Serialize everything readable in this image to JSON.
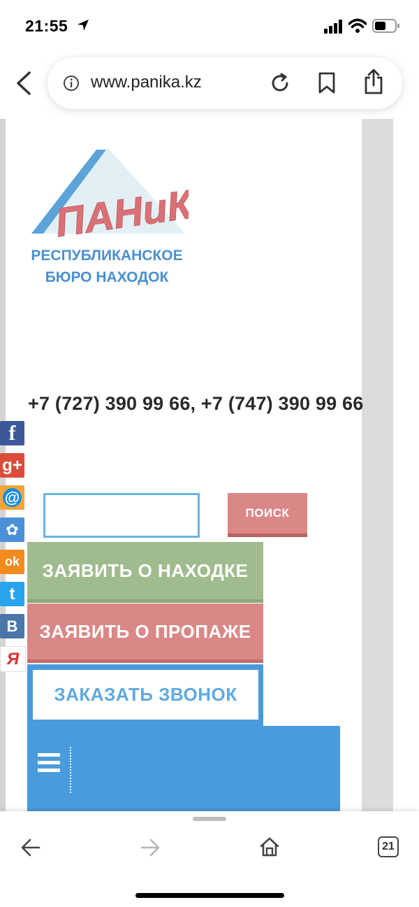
{
  "status_bar": {
    "time": "21:55"
  },
  "browser": {
    "url": "www.panika.kz",
    "tab_count": "21"
  },
  "logo": {
    "brand": "ПАНиКа",
    "line1": "РЕСПУБЛИКАНСКОЕ",
    "line2": "БЮРО НАХОДОК"
  },
  "contact": {
    "phones": "+7 (727) 390 99 66, +7 (747) 390 99 66"
  },
  "search": {
    "value": "",
    "button_label": "ПОИСК"
  },
  "actions": {
    "report_found": "ЗАЯВИТЬ О НАХОДКЕ",
    "report_lost": "ЗАЯВИТЬ О ПРОПАЖЕ",
    "order_call": "ЗАКАЗАТЬ ЗВОНОК"
  },
  "social": [
    {
      "name": "facebook",
      "glyph": "f",
      "color": "#3b5998"
    },
    {
      "name": "google-plus",
      "glyph": "g+",
      "color": "#dd4b39"
    },
    {
      "name": "mail-ru",
      "glyph": "@",
      "color": "#168de2"
    },
    {
      "name": "my-world",
      "glyph": "✿",
      "color": "#4a90d9"
    },
    {
      "name": "odnoklassniki",
      "glyph": "ok",
      "color": "#f28b1e"
    },
    {
      "name": "twitter",
      "glyph": "t",
      "color": "#2aa3ef"
    },
    {
      "name": "vkontakte",
      "glyph": "B",
      "color": "#4a76a8"
    },
    {
      "name": "yandex",
      "glyph": "Я",
      "color": "#ffffff"
    }
  ],
  "colors": {
    "found_green": "#a0bc8e",
    "lost_red": "#d98887",
    "brand_blue": "#4a9bdc"
  }
}
